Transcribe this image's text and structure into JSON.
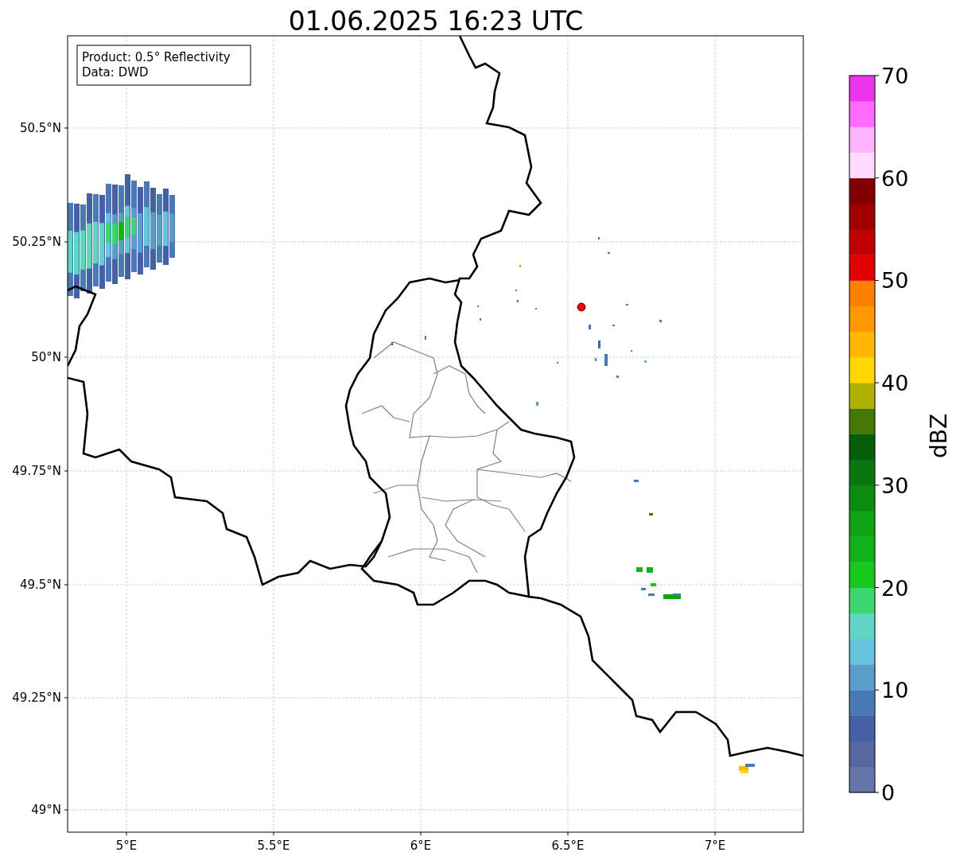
{
  "title": "01.06.2025 16:23 UTC",
  "info_box": [
    "Product: 0.5° Reflectivity",
    "Data: DWD"
  ],
  "map": {
    "x_tick_labels": [
      "5°E",
      "5.5°E",
      "6°E",
      "6.5°E",
      "7°E"
    ],
    "y_tick_labels": [
      "50.5°N",
      "50.25°N",
      "50°N",
      "49.75°N",
      "49.5°N",
      "49.25°N",
      "49°N"
    ]
  },
  "colorbar": {
    "label": "dBZ",
    "tick_labels": [
      "70",
      "60",
      "50",
      "40",
      "30",
      "20",
      "10",
      "0"
    ],
    "bins": [
      {
        "color": "#6675a8"
      },
      {
        "color": "#5566a0"
      },
      {
        "color": "#4560a5"
      },
      {
        "color": "#4a7ab4"
      },
      {
        "color": "#5b9dc8"
      },
      {
        "color": "#65c3dc"
      },
      {
        "color": "#62d5c2"
      },
      {
        "color": "#3cd66e"
      },
      {
        "color": "#14c81e"
      },
      {
        "color": "#10b41a"
      },
      {
        "color": "#0ea414"
      },
      {
        "color": "#0b8c10"
      },
      {
        "color": "#0a780e"
      },
      {
        "color": "#055e0a"
      },
      {
        "color": "#467808"
      },
      {
        "color": "#b0b000"
      },
      {
        "color": "#ffd700"
      },
      {
        "color": "#ffb700"
      },
      {
        "color": "#ff9800"
      },
      {
        "color": "#ff7f00"
      },
      {
        "color": "#e00000"
      },
      {
        "color": "#c00000"
      },
      {
        "color": "#a00000"
      },
      {
        "color": "#800000"
      },
      {
        "color": "#ffdcff"
      },
      {
        "color": "#ffb4ff"
      },
      {
        "color": "#ff6cff"
      },
      {
        "color": "#ee33ee"
      }
    ]
  }
}
